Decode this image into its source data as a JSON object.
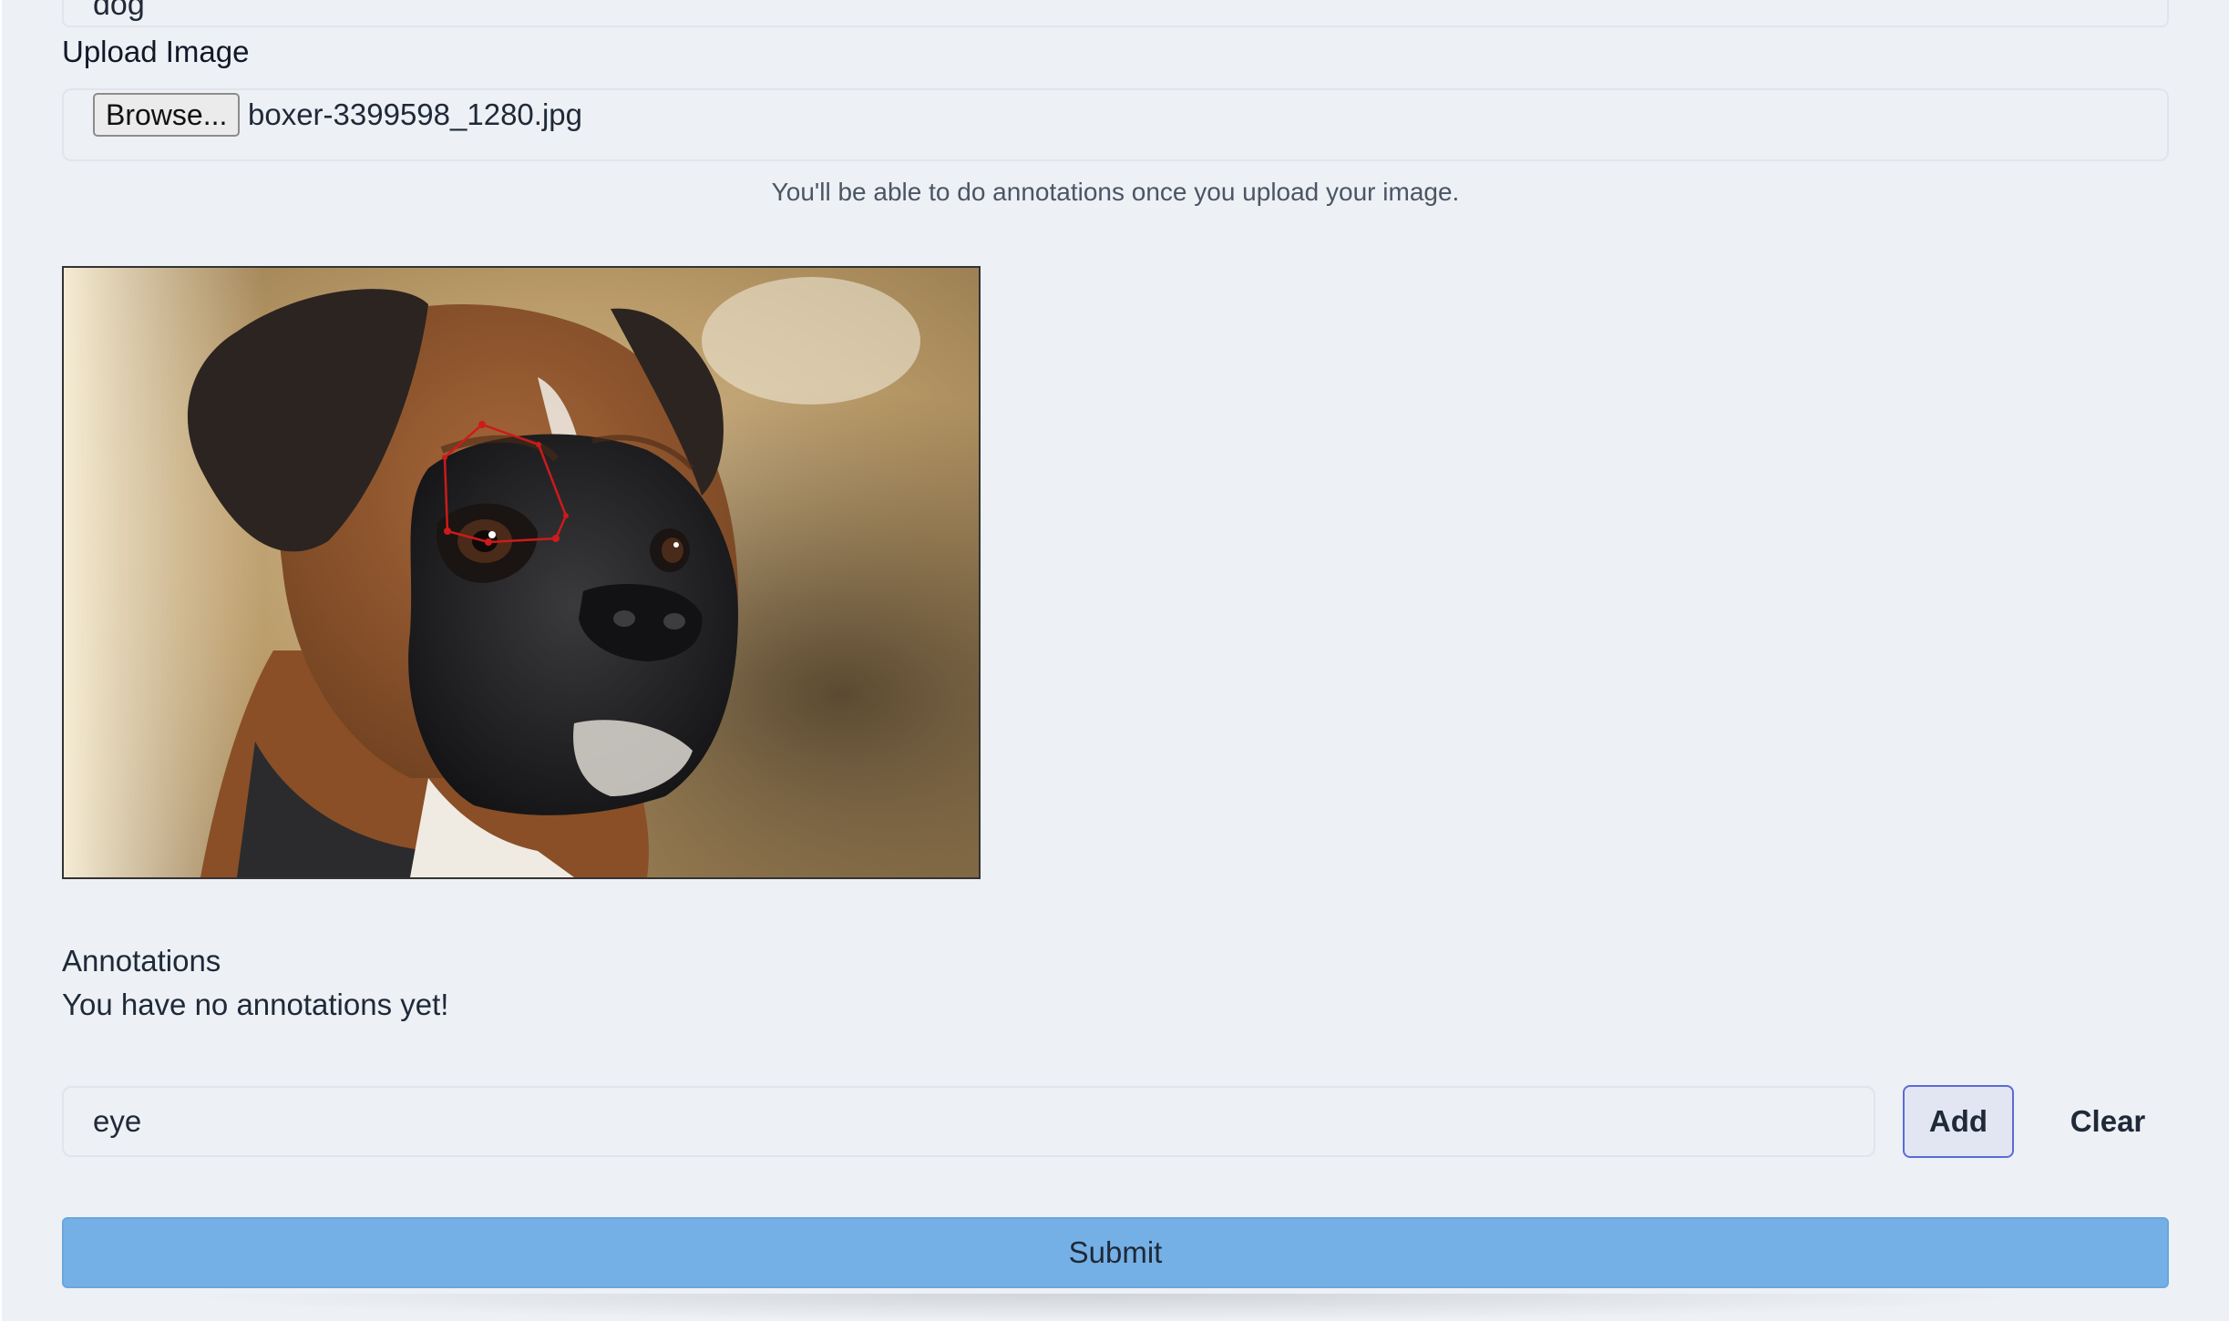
{
  "category_field": {
    "value": "dog"
  },
  "upload": {
    "label": "Upload Image",
    "browse_label": "Browse...",
    "file_name": "boxer-3399598_1280.jpg",
    "hint": "You'll be able to do annotations once you upload your image."
  },
  "image": {
    "subject": "boxer dog photo",
    "polygon_color": "#cc1b1b"
  },
  "annotations": {
    "title": "Annotations",
    "empty_text": "You have no annotations yet!"
  },
  "label_entry": {
    "value": "eye",
    "add_label": "Add",
    "clear_label": "Clear"
  },
  "submit": {
    "label": "Submit"
  },
  "colors": {
    "background": "#edf0f5",
    "submit_blue": "#74b0e6",
    "add_border": "#5b6bd6"
  }
}
